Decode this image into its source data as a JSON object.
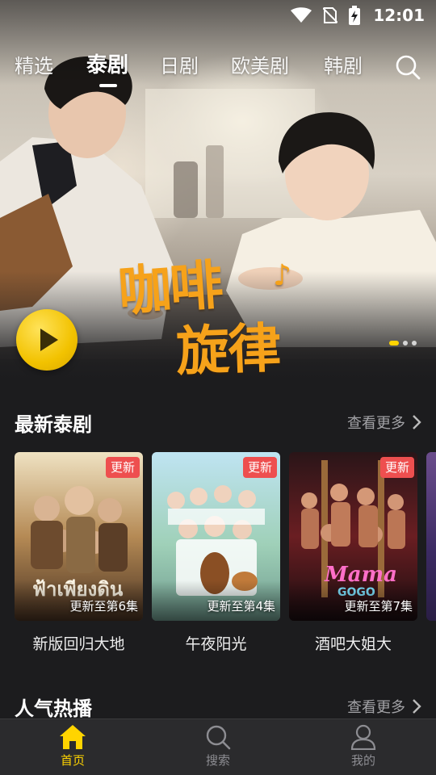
{
  "status_bar": {
    "time": "12:01"
  },
  "top_nav": {
    "tabs": [
      {
        "label": "精选",
        "active": false
      },
      {
        "label": "泰剧",
        "active": true
      },
      {
        "label": "日剧",
        "active": false
      },
      {
        "label": "欧美剧",
        "active": false
      },
      {
        "label": "韩剧",
        "active": false
      }
    ],
    "search_icon": "search-icon"
  },
  "banner": {
    "title_line1": "咖啡",
    "title_line2": "旋律",
    "play_icon": "play-icon",
    "page_count": 3,
    "active_page": 1
  },
  "latest_section": {
    "title": "最新泰剧",
    "see_more": "查看更多",
    "items": [
      {
        "title": "新版回归大地",
        "badge": "更新",
        "episode": "更新至第6集"
      },
      {
        "title": "午夜阳光",
        "badge": "更新",
        "episode": "更新至第4集"
      },
      {
        "title": "酒吧大姐大",
        "badge": "更新",
        "episode": "更新至第7集"
      }
    ]
  },
  "popular_section": {
    "title": "人气热播",
    "see_more": "查看更多"
  },
  "bottom_nav": {
    "items": [
      {
        "label": "首页",
        "icon": "home-icon",
        "active": true
      },
      {
        "label": "搜索",
        "icon": "search-icon",
        "active": false
      },
      {
        "label": "我的",
        "icon": "profile-icon",
        "active": false
      }
    ]
  },
  "colors": {
    "accent": "#ffd400",
    "badge": "#ee4f4f",
    "background": "#1c1c1e",
    "nav_background": "#2b2b2d"
  }
}
